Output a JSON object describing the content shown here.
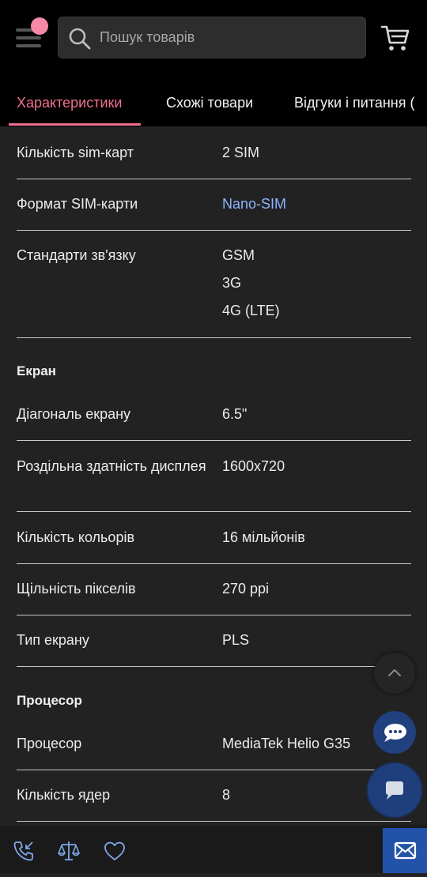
{
  "header": {
    "search_placeholder": "Пошук товарів"
  },
  "tabs": [
    {
      "label": "Характеристики",
      "active": true
    },
    {
      "label": "Схожі товари",
      "active": false
    },
    {
      "label": "Відгуки і питання (",
      "active": false
    }
  ],
  "specs": {
    "sim_count": {
      "label": "Кількість sim-карт",
      "value": "2 SIM"
    },
    "sim_format": {
      "label": "Формат SIM-карти",
      "value": "Nano-SIM"
    },
    "standards": {
      "label": "Стандарти зв'язку",
      "values": [
        "GSM",
        "3G",
        "4G (LTE)"
      ]
    },
    "screen_section": "Екран",
    "diagonal": {
      "label": "Діагональ екрану",
      "value": "6.5\""
    },
    "resolution": {
      "label": "Роздільна здатність дисплея",
      "value": "1600x720"
    },
    "colors": {
      "label": "Кількість кольорів",
      "value": "16 мільйонів"
    },
    "ppi": {
      "label": "Щільність пікселів",
      "value": "270 ppi"
    },
    "screen_type": {
      "label": "Тип екрану",
      "value": "PLS"
    },
    "cpu_section": "Процесор",
    "cpu": {
      "label": "Процесор",
      "value": "MediaTek Helio G35"
    },
    "cores": {
      "label": "Кількість ядер",
      "value": "8"
    }
  },
  "icons": {
    "menu": "hamburger-menu-icon",
    "search": "search-icon",
    "cart": "cart-icon",
    "scroll_up": "chevron-up-icon",
    "chat": "chat-bubbles-icon",
    "message": "message-icon",
    "phone": "phone-callback-icon",
    "compare": "scales-icon",
    "favorite": "heart-icon",
    "mail": "mail-icon"
  },
  "colors": {
    "accent": "#f06f8e",
    "link": "#8cb4ff",
    "background": "#222223",
    "chat_blue": "#20407e",
    "mail_blue": "#2253a8"
  }
}
